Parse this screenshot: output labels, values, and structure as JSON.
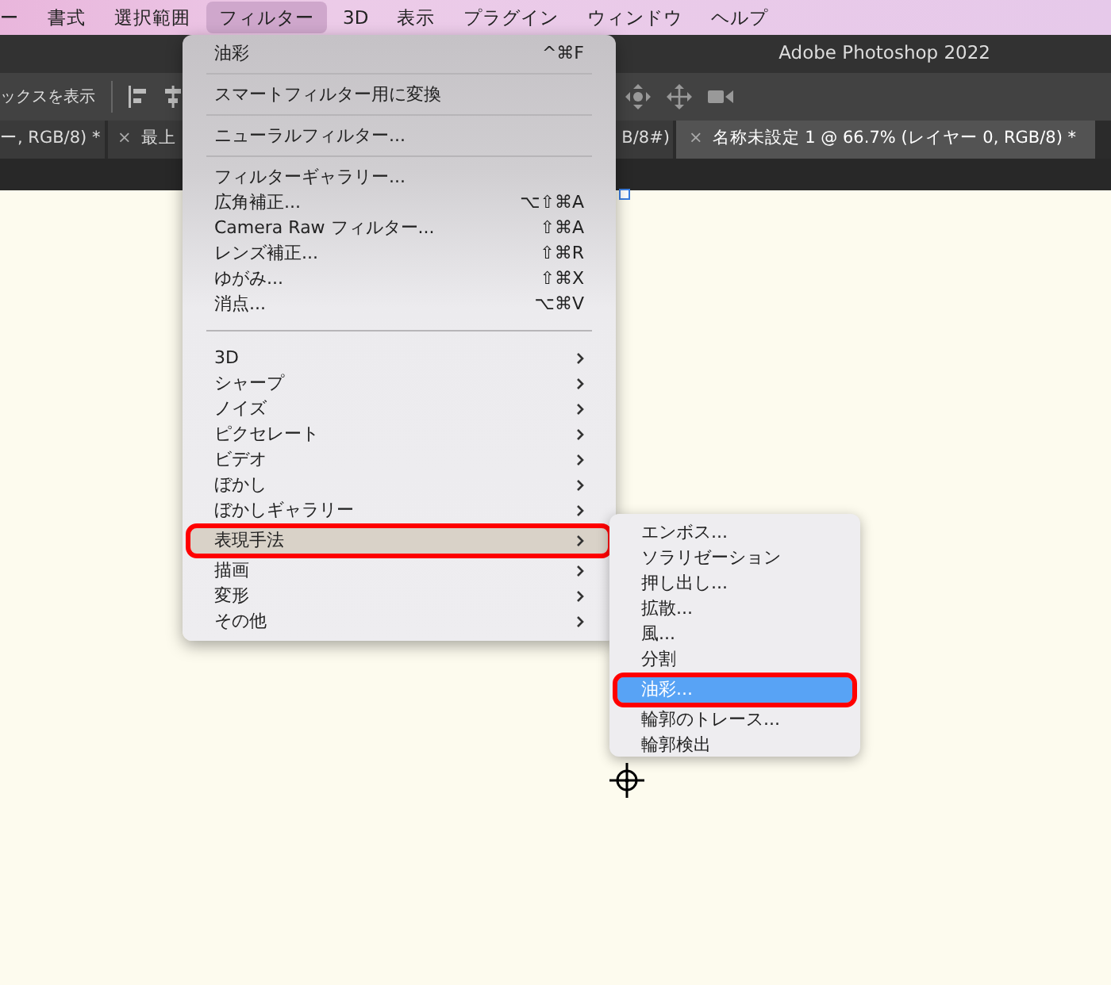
{
  "menubar": [
    {
      "label": "ー",
      "selected": false
    },
    {
      "label": "書式",
      "selected": false
    },
    {
      "label": "選択範囲",
      "selected": false
    },
    {
      "label": "フィルター",
      "selected": true
    },
    {
      "label": "3D",
      "selected": false
    },
    {
      "label": "表示",
      "selected": false
    },
    {
      "label": "プラグイン",
      "selected": false
    },
    {
      "label": "ウィンドウ",
      "selected": false
    },
    {
      "label": "ヘルプ",
      "selected": false
    }
  ],
  "window": {
    "title": "Adobe Photoshop 2022"
  },
  "toolbar": {
    "label": "ックスを表示"
  },
  "tabs": [
    {
      "label": "ー, RGB/8) *",
      "selected": false
    },
    {
      "label": "最上",
      "close": "×",
      "selected": false
    },
    {
      "label": "B/8#)",
      "selected": false
    },
    {
      "label": "名称未設定 1 @ 66.7% (レイヤー 0, RGB/8) *",
      "close": "×",
      "selected": true
    }
  ],
  "filter_menu": {
    "items": [
      {
        "kind": "item",
        "label": "油彩",
        "shortcut": "^⌘F",
        "selected": false,
        "marked": false
      },
      {
        "kind": "separator"
      },
      {
        "kind": "item",
        "label": "スマートフィルター用に変換",
        "selected": false,
        "marked": false
      },
      {
        "kind": "separator"
      },
      {
        "kind": "item",
        "label": "ニューラルフィルター...",
        "selected": false,
        "marked": false
      },
      {
        "kind": "separator"
      },
      {
        "kind": "item",
        "label": "フィルターギャラリー...",
        "selected": false,
        "marked": false
      },
      {
        "kind": "item",
        "label": "広角補正...",
        "shortcut": "⌥⇧⌘A",
        "selected": false,
        "marked": false
      },
      {
        "kind": "item",
        "label": "Camera Raw フィルター...",
        "shortcut": "⇧⌘A",
        "selected": false,
        "marked": false
      },
      {
        "kind": "item",
        "label": "レンズ補正...",
        "shortcut": "⇧⌘R",
        "selected": false,
        "marked": false
      },
      {
        "kind": "item",
        "label": "ゆがみ...",
        "shortcut": "⇧⌘X",
        "selected": false,
        "marked": false
      },
      {
        "kind": "item",
        "label": "消点...",
        "shortcut": "⌥⌘V",
        "selected": false,
        "marked": false
      },
      {
        "kind": "separator"
      },
      {
        "kind": "submenu",
        "label": "3D",
        "selected": false,
        "marked": false
      },
      {
        "kind": "submenu",
        "label": "シャープ",
        "selected": false,
        "marked": false
      },
      {
        "kind": "submenu",
        "label": "ノイズ",
        "selected": false,
        "marked": false
      },
      {
        "kind": "submenu",
        "label": "ピクセレート",
        "selected": false,
        "marked": false
      },
      {
        "kind": "submenu",
        "label": "ビデオ",
        "selected": false,
        "marked": false
      },
      {
        "kind": "submenu",
        "label": "ぼかし",
        "selected": false,
        "marked": false
      },
      {
        "kind": "submenu",
        "label": "ぼかしギャラリー",
        "selected": false,
        "marked": false
      },
      {
        "kind": "submenu",
        "label": "表現手法",
        "selected": true,
        "marked": true
      },
      {
        "kind": "submenu",
        "label": "描画",
        "selected": false,
        "marked": false
      },
      {
        "kind": "submenu",
        "label": "変形",
        "selected": false,
        "marked": false
      },
      {
        "kind": "submenu",
        "label": "その他",
        "selected": false,
        "marked": false
      }
    ]
  },
  "stylize_submenu": {
    "items": [
      {
        "label": "エンボス...",
        "selected": false,
        "marked": false
      },
      {
        "label": "ソラリゼーション",
        "selected": false,
        "marked": false
      },
      {
        "label": "押し出し...",
        "selected": false,
        "marked": false
      },
      {
        "label": "拡散...",
        "selected": false,
        "marked": false
      },
      {
        "label": "風...",
        "selected": false,
        "marked": false
      },
      {
        "label": "分割",
        "selected": false,
        "marked": false
      },
      {
        "label": "油彩...",
        "selected": true,
        "marked": true
      },
      {
        "label": "輪郭のトレース...",
        "selected": false,
        "marked": false
      },
      {
        "label": "輪郭検出",
        "selected": false,
        "marked": false
      }
    ]
  }
}
